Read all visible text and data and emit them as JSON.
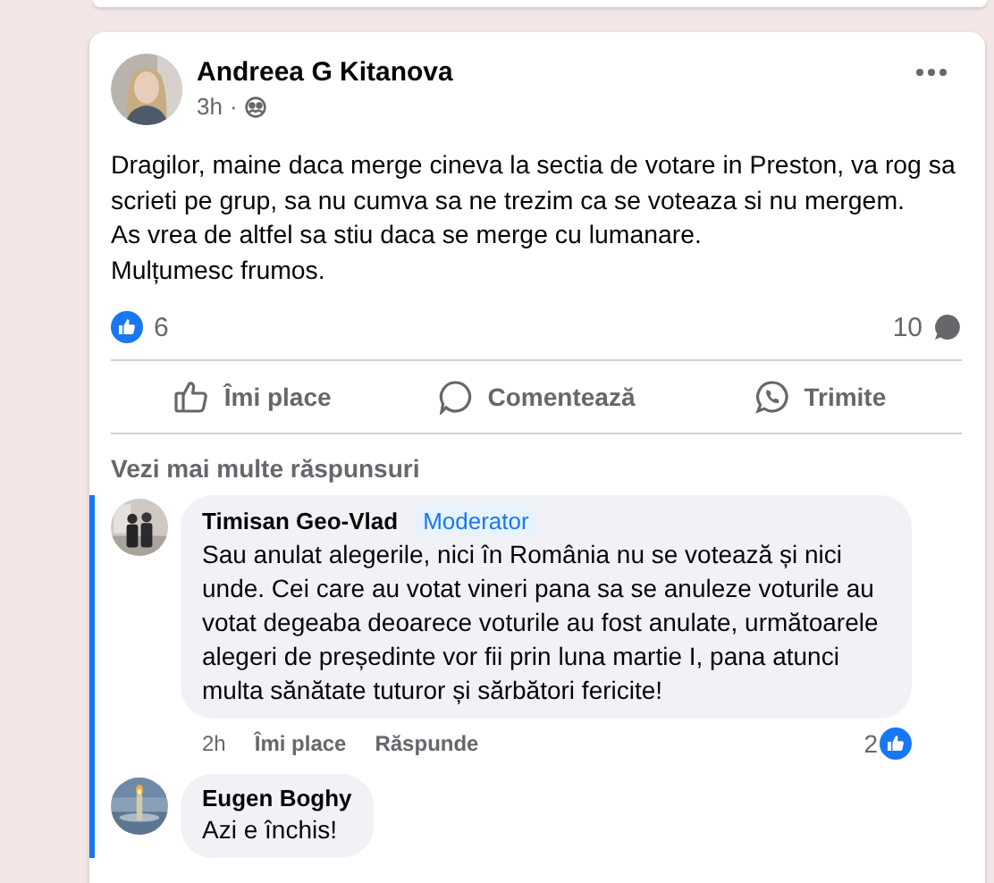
{
  "post": {
    "author": "Andreea G Kitanova",
    "time": "3h",
    "separator": "·",
    "text_lines": [
      "Dragilor, maine daca merge cineva la sectia de votare in Preston, va rog sa scrieti pe grup, sa nu cumva sa ne trezim ca se voteaza si nu mergem.",
      "As vrea de altfel sa stiu daca se merge cu lumanare.",
      "Mulțumesc frumos."
    ],
    "reaction_count": "6",
    "comment_count": "10",
    "actions": [
      {
        "kind": "like",
        "label": "Îmi place"
      },
      {
        "kind": "comment",
        "label": "Comentează"
      },
      {
        "kind": "share",
        "label": "Trimite"
      }
    ],
    "more_replies": "Vezi mai multe răspunsuri",
    "comments": [
      {
        "kind": "person",
        "author": "Timisan Geo-Vlad",
        "badge": "Moderator",
        "text": "Sau anulat alegerile, nici în România nu se votează și nici unde. Cei care au votat vineri pana sa se anuleze voturile au votat degeaba deoarece voturile au fost anulate, următoarele alegeri de președinte vor fii prin luna martie I, pana atunci multa sănătate tuturor și sărbători fericite!",
        "time": "2h",
        "like": "Îmi place",
        "reply": "Răspunde",
        "reactions": "2"
      },
      {
        "kind": "scene",
        "author": "Eugen Boghy",
        "text": "Azi e închis!"
      }
    ]
  }
}
